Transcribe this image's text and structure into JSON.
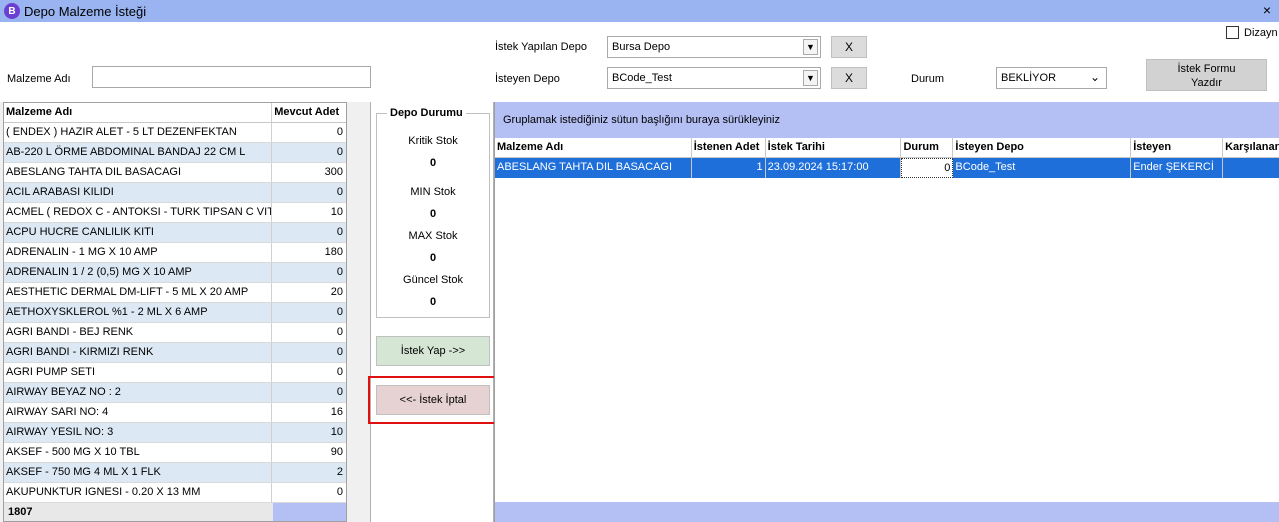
{
  "window": {
    "title": "Depo Malzeme İsteği",
    "app_icon_letter": "B",
    "close_symbol": "×"
  },
  "filters": {
    "malzeme_adi_label": "Malzeme Adı",
    "malzeme_adi_value": "",
    "istek_yapilan_depo_label": "İstek Yapılan Depo",
    "istek_yapilan_depo_value": "Bursa Depo",
    "isteyen_depo_label": "İsteyen Depo",
    "isteyen_depo_value": "BCode_Test",
    "clear_symbol": "X",
    "durum_label": "Durum",
    "durum_value": "BEKLİYOR",
    "print_button_line1": "İstek Formu",
    "print_button_line2": "Yazdır",
    "dizayn_label": "Dizayn"
  },
  "materials": {
    "columns": [
      "Malzeme Adı",
      "Mevcut Adet"
    ],
    "rows": [
      [
        "( ENDEX ) HAZIR ALET - 5 LT DEZENFEKTAN",
        "0"
      ],
      [
        "AB-220 L  ÖRME ABDOMINAL BANDAJ 22 CM L",
        "0"
      ],
      [
        "ABESLANG TAHTA DIL BASACAGI",
        "300"
      ],
      [
        "ACIL ARABASI KILIDI",
        "0"
      ],
      [
        "ACMEL ( REDOX C - ANTOKSI -  TURK TIPSAN C VIT",
        "10"
      ],
      [
        "ACPU HUCRE CANLILIK KITI",
        "0"
      ],
      [
        "ADRENALIN - 1 MG X 10 AMP",
        "180"
      ],
      [
        "ADRENALIN 1 / 2 (0,5) MG X 10 AMP",
        "0"
      ],
      [
        "AESTHETIC DERMAL DM-LIFT - 5 ML X 20 AMP",
        "20"
      ],
      [
        "AETHOXYSKLEROL %1 - 2 ML X 6 AMP",
        "0"
      ],
      [
        "AGRI BANDI - BEJ RENK",
        "0"
      ],
      [
        "AGRI BANDI - KIRMIZI RENK",
        "0"
      ],
      [
        "AGRI PUMP SETI",
        "0"
      ],
      [
        "AIRWAY BEYAZ NO : 2",
        "0"
      ],
      [
        "AIRWAY SARI NO: 4",
        "16"
      ],
      [
        "AIRWAY YESIL NO: 3",
        "10"
      ],
      [
        "AKSEF - 500 MG X  10 TBL",
        "90"
      ],
      [
        "AKSEF - 750 MG 4 ML X 1 FLK",
        "2"
      ],
      [
        "AKUPUNKTUR IGNESI - 0.20 X 13 MM",
        "0"
      ]
    ],
    "total_count": "1807"
  },
  "depo_durumu": {
    "title": "Depo Durumu",
    "kritik_stok_label": "Kritik Stok",
    "kritik_stok_value": "0",
    "min_stok_label": "MIN Stok",
    "min_stok_value": "0",
    "max_stok_label": "MAX Stok",
    "max_stok_value": "0",
    "guncel_stok_label": "Güncel Stok",
    "guncel_stok_value": "0"
  },
  "actions": {
    "istek_yap_label": "İstek Yap ->>",
    "istek_iptal_label": "<<- İstek İptal"
  },
  "requests": {
    "group_hint": "Gruplamak istediğiniz sütun başlığını buraya sürükleyiniz",
    "columns": [
      "Malzeme Adı",
      "İstenen Adet",
      "İstek Tarihi",
      "Durum",
      "İsteyen Depo",
      "İsteyen",
      "Karşılanan"
    ],
    "rows": [
      [
        "ABESLANG TAHTA DIL BASACAGI",
        "1",
        "23.09.2024 15:17:00",
        "0",
        "BCode_Test",
        "Ender ŞEKERCİ",
        ""
      ]
    ]
  }
}
